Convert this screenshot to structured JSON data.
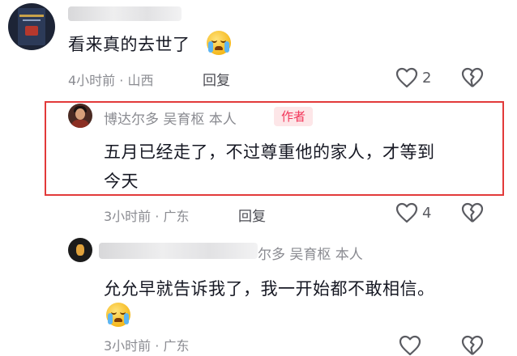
{
  "comments": [
    {
      "text": "看来真的去世了",
      "meta": "4小时前 · 山西",
      "reply_label": "回复",
      "like_count": "2"
    },
    {
      "user": "博达尔多 吴育枢 本人",
      "badge": "作者",
      "text_line1": "五月已经走了，不过尊重他的家人，才等到",
      "text_line2": "今天",
      "meta": "3小时前 · 广东",
      "reply_label": "回复",
      "like_count": "4"
    },
    {
      "user_visible": "尔多 吴育枢 本人",
      "text": "允允早就告诉我了，我一开始都不敢相信。",
      "meta": "3小时前 · 广东"
    }
  ],
  "icons": {
    "like": "heart-outline-icon",
    "dislike": "broken-heart-icon",
    "emoji": "loudly-crying-face-emoji"
  },
  "colors": {
    "highlight_border": "#e23a3a",
    "author_badge_text": "#f2365a",
    "author_badge_bg": "#fde6e8",
    "meta_text": "#8a8b91"
  }
}
